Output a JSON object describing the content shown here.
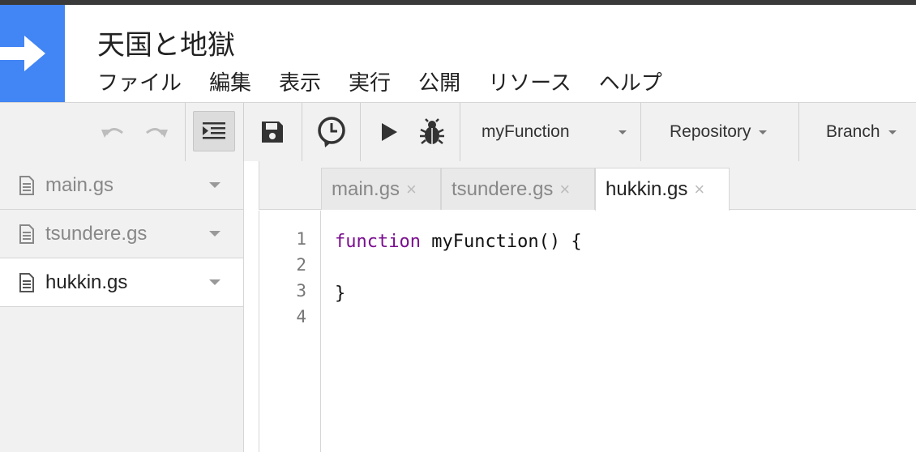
{
  "project_title": "天国と地獄",
  "menu": [
    "ファイル",
    "編集",
    "表示",
    "実行",
    "公開",
    "リソース",
    "ヘルプ"
  ],
  "toolbar": {
    "function_select": "myFunction",
    "repository_label": "Repository",
    "branch_label": "Branch"
  },
  "files": [
    {
      "name": "main.gs",
      "active": false
    },
    {
      "name": "tsundere.gs",
      "active": false
    },
    {
      "name": "hukkin.gs",
      "active": true
    }
  ],
  "tabs": [
    {
      "name": "main.gs",
      "close": "×",
      "active": false
    },
    {
      "name": "tsundere.gs",
      "close": "×",
      "active": false
    },
    {
      "name": "hukkin.gs",
      "close": "×",
      "active": true
    }
  ],
  "code": {
    "line_numbers": [
      "1",
      "2",
      "3",
      "4"
    ],
    "keyword": "function",
    "line1_rest": " myFunction() {",
    "line2": "",
    "line3": "}",
    "line4": ""
  },
  "colors": {
    "brand": "#4285f4",
    "keyword": "#7a0f8f"
  }
}
